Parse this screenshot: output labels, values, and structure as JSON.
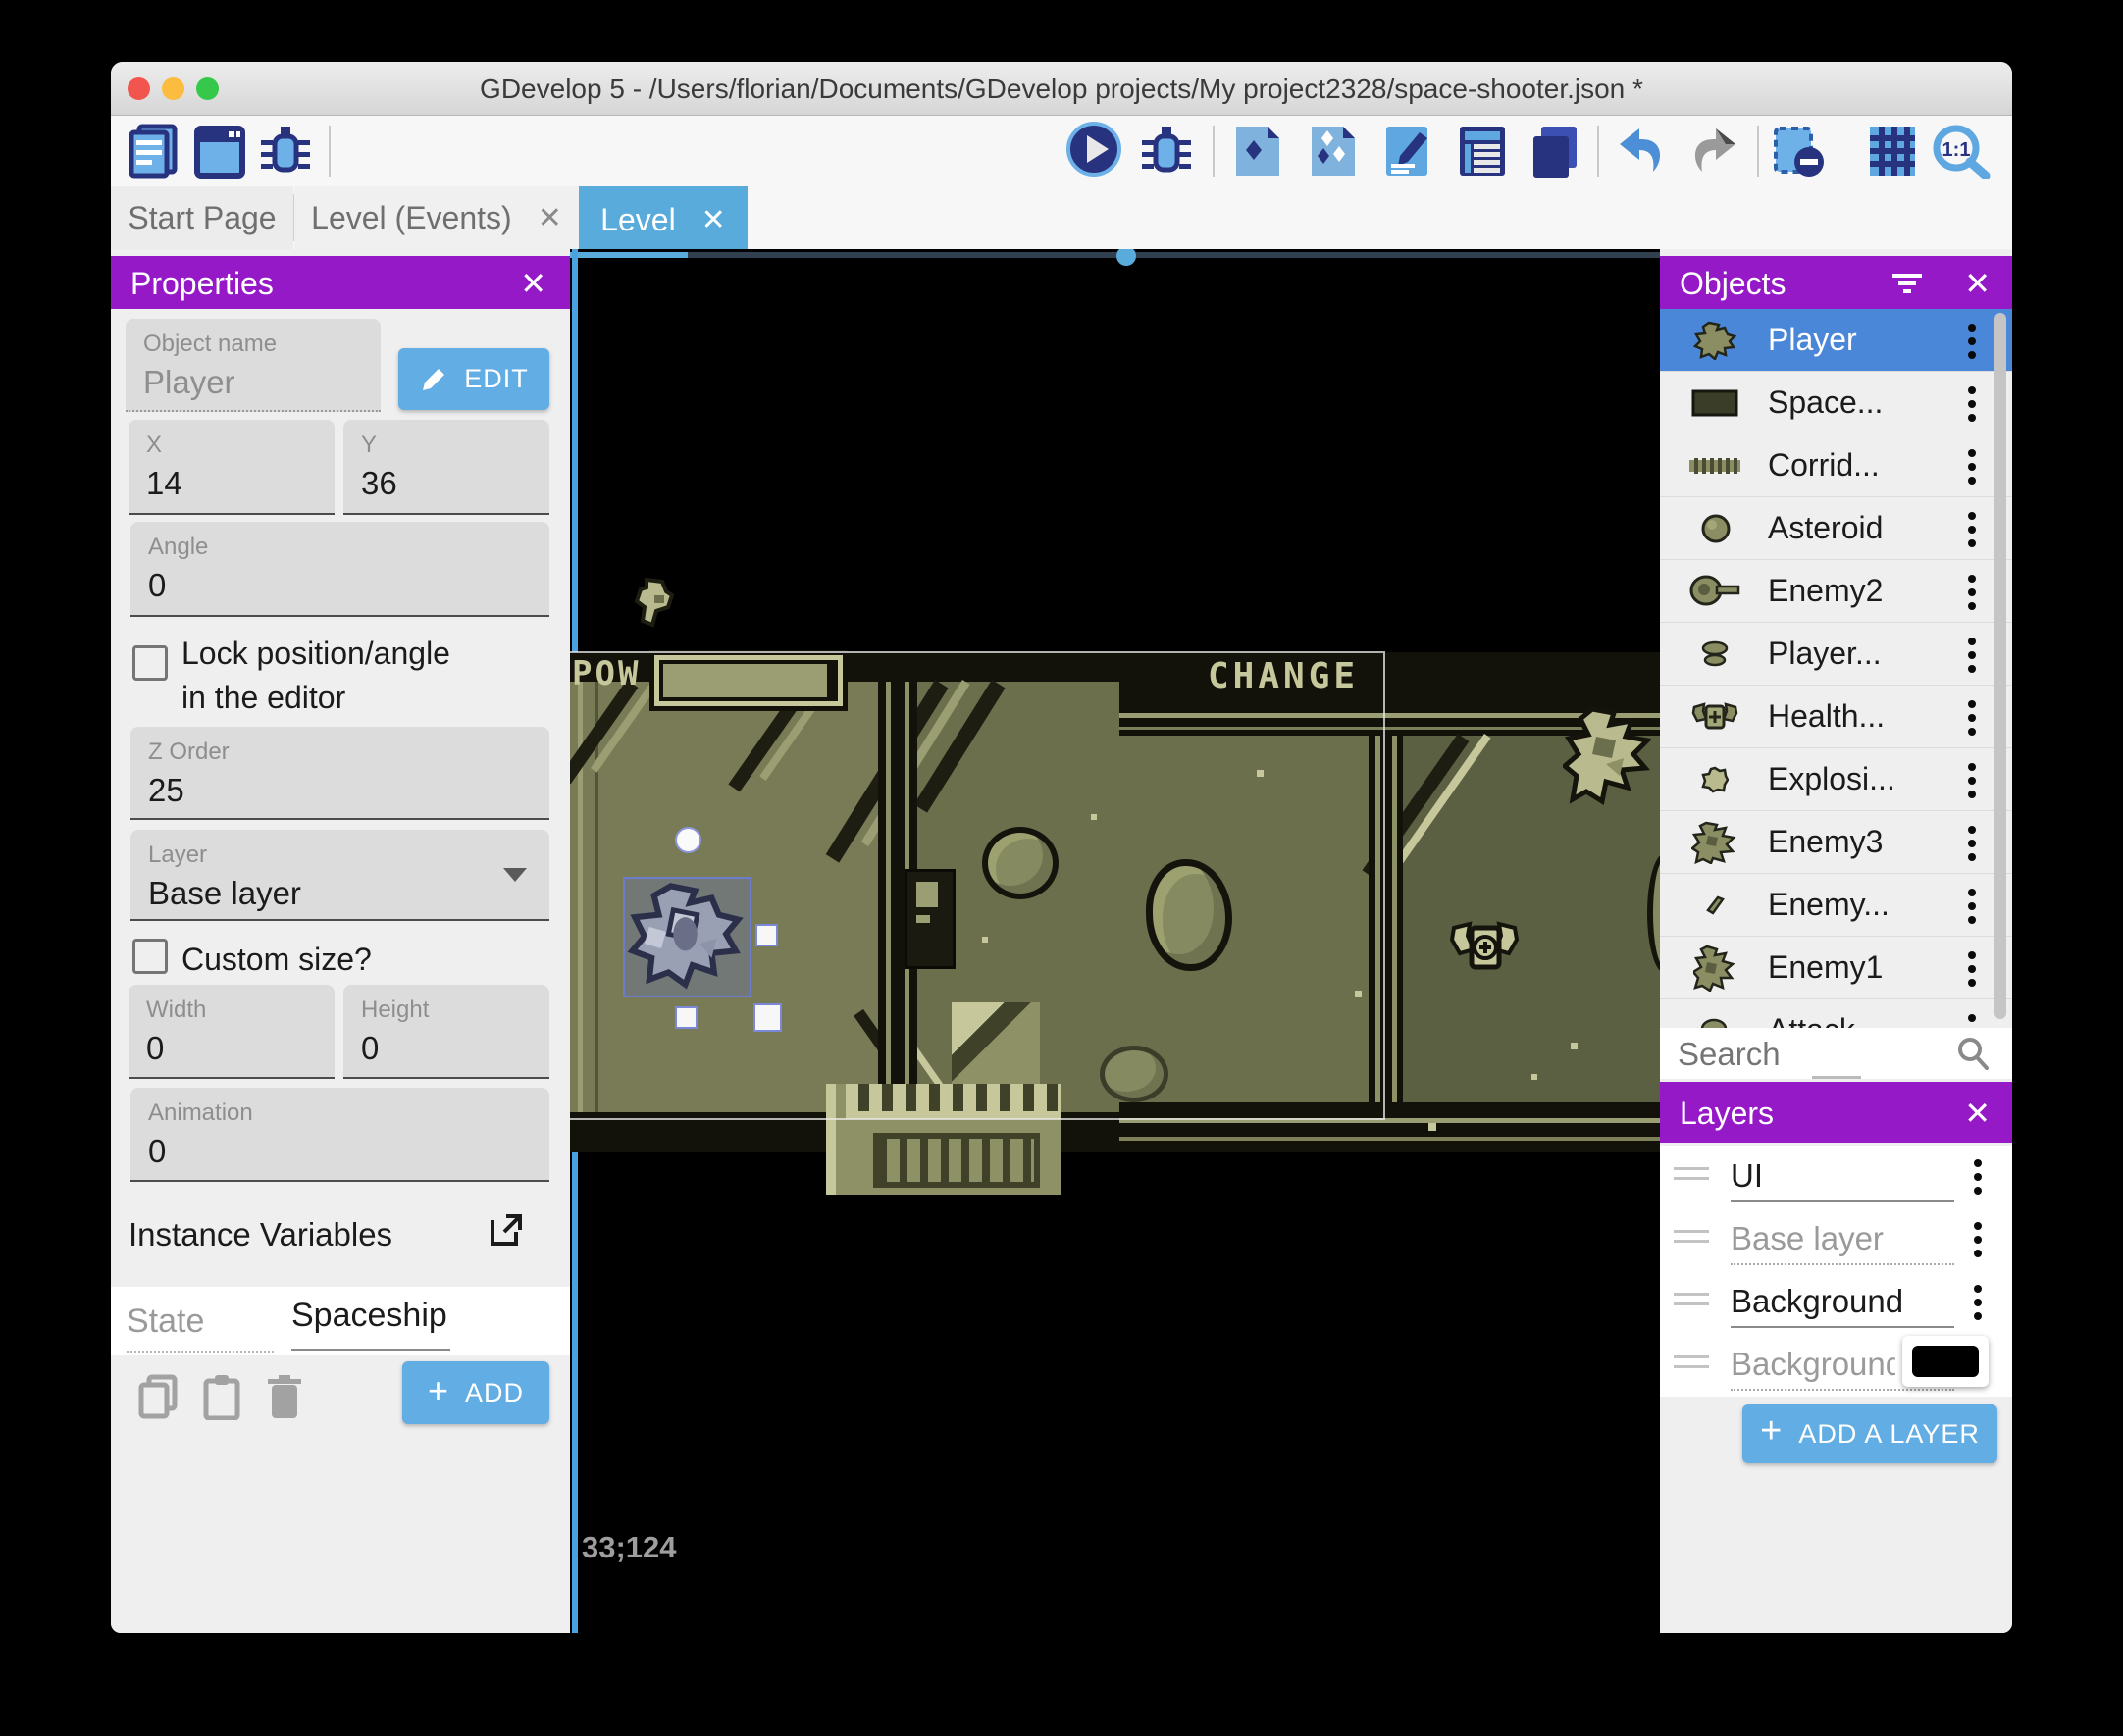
{
  "window": {
    "title": "GDevelop 5 - /Users/florian/Documents/GDevelop projects/My project2328/space-shooter.json *"
  },
  "toolbar": {
    "icons_left": [
      "project-manager-icon",
      "preview-window-icon",
      "debug-icon"
    ],
    "icons_right": [
      "play-icon",
      "debug-icon",
      "add-object-icon",
      "add-objects-icon",
      "edit-scene-icon",
      "events-list-icon",
      "instances-list-icon",
      "undo-icon",
      "redo-icon",
      "mask-icon",
      "grid-icon",
      "zoom-1-1-icon"
    ]
  },
  "tabs": {
    "items": [
      {
        "label": "Start Page",
        "closable": false,
        "active": false
      },
      {
        "label": "Level (Events)",
        "close": "✕",
        "closable": true,
        "active": false
      },
      {
        "label": "Level",
        "close": "✕",
        "closable": true,
        "active": true
      }
    ]
  },
  "properties": {
    "title": "Properties",
    "close": "✕",
    "object_name_label": "Object name",
    "object_name_value": "Player",
    "edit_button": "EDIT",
    "x_label": "X",
    "x_value": "14",
    "y_label": "Y",
    "y_value": "36",
    "angle_label": "Angle",
    "angle_value": "0",
    "lock_checkbox_label": "Lock position/angle in the editor",
    "z_order_label": "Z Order",
    "z_order_value": "25",
    "layer_label": "Layer",
    "layer_value": "Base layer",
    "custom_size_label": "Custom size?",
    "width_label": "Width",
    "width_value": "0",
    "height_label": "Height",
    "height_value": "0",
    "animation_label": "Animation",
    "animation_value": "0",
    "instance_variables_title": "Instance Variables",
    "variable_name": "State",
    "variable_value": "Spaceship",
    "add_button": "ADD"
  },
  "scene": {
    "pow_label": "POW",
    "change_label": "CHANGE",
    "cursor_coordinates": "33;124",
    "selected_object": "Player"
  },
  "objects_panel": {
    "title": "Objects",
    "close": "✕",
    "search_placeholder": "Search",
    "items": [
      {
        "name": "Player",
        "selected": true
      },
      {
        "name": "Space...",
        "selected": false
      },
      {
        "name": "Corrid...",
        "selected": false
      },
      {
        "name": "Asteroid",
        "selected": false
      },
      {
        "name": "Enemy2",
        "selected": false
      },
      {
        "name": "Player...",
        "selected": false
      },
      {
        "name": "Health...",
        "selected": false
      },
      {
        "name": "Explosi...",
        "selected": false
      },
      {
        "name": "Enemy3",
        "selected": false
      },
      {
        "name": "Enemy...",
        "selected": false
      },
      {
        "name": "Enemy1",
        "selected": false
      },
      {
        "name": "Attack...",
        "selected": false
      }
    ]
  },
  "layers_panel": {
    "title": "Layers",
    "close": "✕",
    "items": [
      {
        "name": "UI"
      },
      {
        "name": "Base layer"
      },
      {
        "name": "Background"
      },
      {
        "name": "Background"
      }
    ],
    "swatch_color": "#000000",
    "add_button": "ADD A LAYER"
  },
  "colors": {
    "accent_purple": "#9619c8",
    "accent_blue": "#62ade3",
    "active_tab_blue": "#58abda",
    "selected_row_blue": "#4b87d8",
    "scene_khaki_light": "#c6c89b",
    "scene_olive": "#6b6f4c",
    "scene_dark": "#12120b",
    "swatch": "#000000"
  }
}
